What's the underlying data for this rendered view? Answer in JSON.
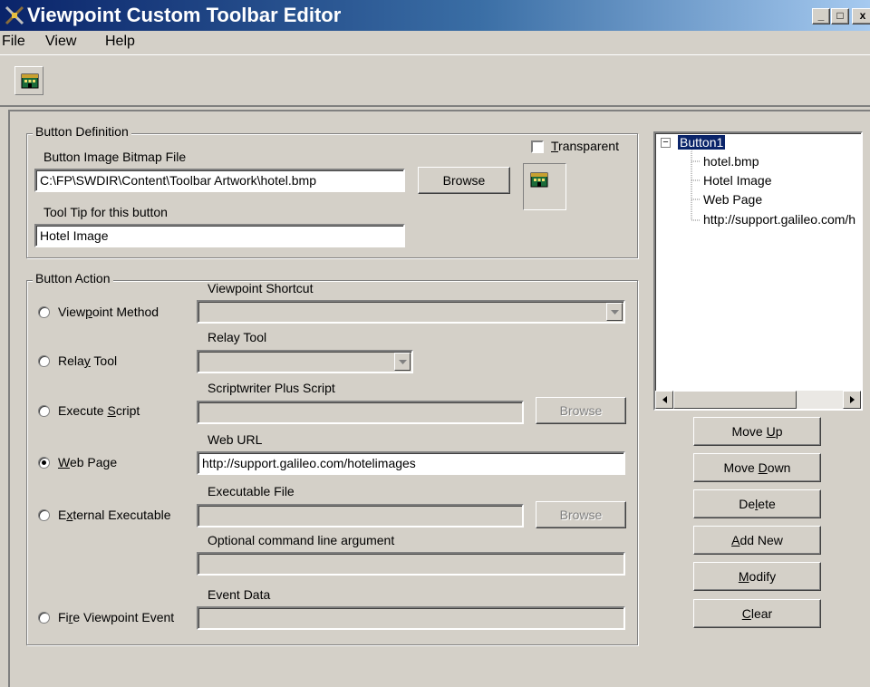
{
  "window": {
    "title": "Viewpoint Custom Toolbar Editor",
    "caption_buttons": {
      "minimize": "_",
      "maximize": "□",
      "close": "x"
    }
  },
  "menu": [
    "File",
    "View",
    "Help"
  ],
  "toolbar": {
    "button_icon": "hotel-icon"
  },
  "button_definition": {
    "caption": "Button Definition",
    "bitmap_label": "Button Image Bitmap File",
    "bitmap_value": "C:\\FP\\SWDIR\\Content\\Toolbar Artwork\\hotel.bmp",
    "browse_label": "Browse",
    "transparent_label": "Transparent",
    "transparent_checked": false,
    "tooltip_label": "Tool Tip for this button",
    "tooltip_value": "Hotel Image",
    "preview_icon": "hotel-icon"
  },
  "button_action": {
    "caption": "Button Action",
    "selected": "Web Page",
    "options": [
      {
        "label": "Viewpoint Method",
        "accel": "p"
      },
      {
        "label": "Relay Tool",
        "accel": "y"
      },
      {
        "label": "Execute Script",
        "accel": "S"
      },
      {
        "label": "Web Page",
        "accel": "W"
      },
      {
        "label": "External Executable",
        "accel": "x"
      },
      {
        "label": "Fire Viewpoint Event",
        "accel": "r"
      }
    ],
    "viewpoint_shortcut_label": "Viewpoint Shortcut",
    "relay_tool_label": "Relay Tool",
    "script_label": "Scriptwriter Plus Script",
    "script_browse": "Browse",
    "web_url_label": "Web URL",
    "web_url_value": "http://support.galileo.com/hotelimages",
    "exe_label": "Executable File",
    "exe_browse": "Browse",
    "cmdline_label": "Optional command line argument",
    "event_label": "Event Data"
  },
  "tree": {
    "root": "Button1",
    "expander": "⊟",
    "children": [
      "hotel.bmp",
      "Hotel Image",
      "Web Page",
      "http://support.galileo.com/h"
    ]
  },
  "actions": {
    "move_up": "Move Up",
    "move_down": "Move Down",
    "delete": "Delete",
    "add_new": "Add New",
    "modify": "Modify",
    "clear": "Clear"
  },
  "colors": {
    "titlebar_start": "#0a246a",
    "titlebar_end": "#a6caf0",
    "face": "#d4d0c8",
    "selection": "#0a246a"
  }
}
